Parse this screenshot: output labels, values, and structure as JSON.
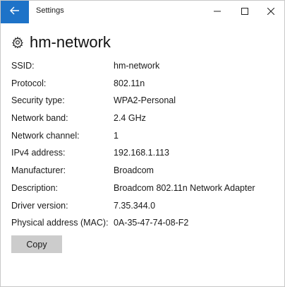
{
  "titlebar": {
    "app_title": "Settings",
    "back_icon": "arrow-left-icon",
    "accent_color": "#1e73c8"
  },
  "page": {
    "title": "hm-network",
    "title_icon": "gear-icon"
  },
  "properties": [
    {
      "label": "SSID:",
      "value": "hm-network"
    },
    {
      "label": "Protocol:",
      "value": "802.11n"
    },
    {
      "label": "Security type:",
      "value": "WPA2-Personal"
    },
    {
      "label": "Network band:",
      "value": "2.4 GHz"
    },
    {
      "label": "Network channel:",
      "value": "1"
    },
    {
      "label": "IPv4 address:",
      "value": "192.168.1.113"
    },
    {
      "label": "Manufacturer:",
      "value": "Broadcom"
    },
    {
      "label": "Description:",
      "value": "Broadcom 802.11n Network Adapter"
    },
    {
      "label": "Driver version:",
      "value": "7.35.344.0"
    },
    {
      "label": "Physical address (MAC):",
      "value": "0A-35-47-74-08-F2"
    }
  ],
  "actions": {
    "copy_label": "Copy"
  }
}
